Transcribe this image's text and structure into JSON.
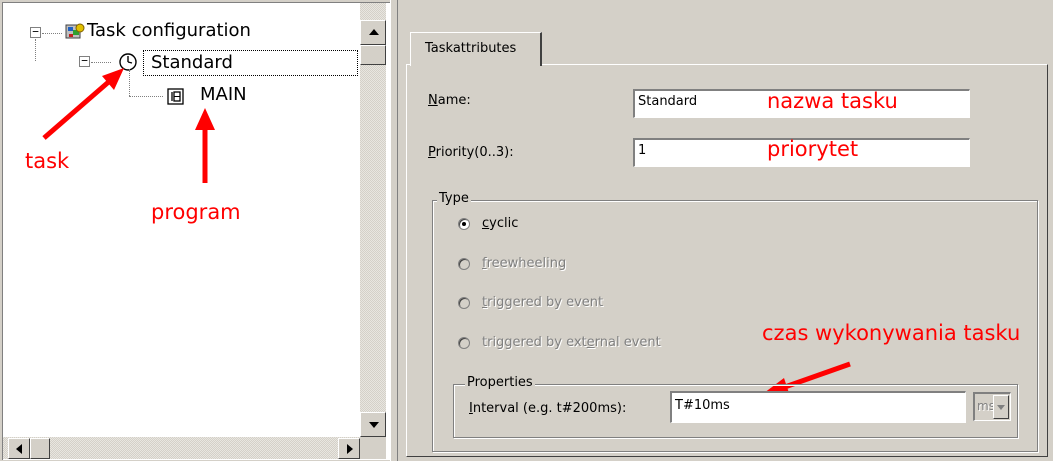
{
  "tree": {
    "root_label": "Task configuration",
    "task_label": "Standard",
    "program_label": "MAIN"
  },
  "tabs": [
    {
      "label": "Taskattributes"
    }
  ],
  "form": {
    "name_label_prefix": "N",
    "name_label_rest": "ame:",
    "name_value": "Standard",
    "priority_label_prefix": "P",
    "priority_label_rest": "riority(0..3):",
    "priority_value": "1"
  },
  "type_group": {
    "title": "Type",
    "options": [
      {
        "label_prefix": "c",
        "label_rest": "yclic",
        "selected": true,
        "enabled": true
      },
      {
        "label_prefix": "f",
        "label_rest": "reewheeling",
        "selected": false,
        "enabled": false
      },
      {
        "label_prefix": "t",
        "label_rest": "riggered by event",
        "selected": false,
        "enabled": false
      },
      {
        "label_before": "triggered by ext",
        "label_prefix": "e",
        "label_rest": "rnal event",
        "selected": false,
        "enabled": false
      }
    ]
  },
  "properties_group": {
    "title": "Properties",
    "interval_label_prefix": "I",
    "interval_label_rest": "nterval (e.g. t#200ms):",
    "interval_value": "T#10ms",
    "unit_value": "ms"
  },
  "annotations": {
    "task": "task",
    "program": "program",
    "task_name": "nazwa tasku",
    "priority": "priorytet",
    "exec_time": "czas wykonywania tasku",
    "color": "#ff0000"
  },
  "icons": {
    "root": "task-config-icon",
    "task": "clock-icon",
    "program": "program-block-icon"
  }
}
